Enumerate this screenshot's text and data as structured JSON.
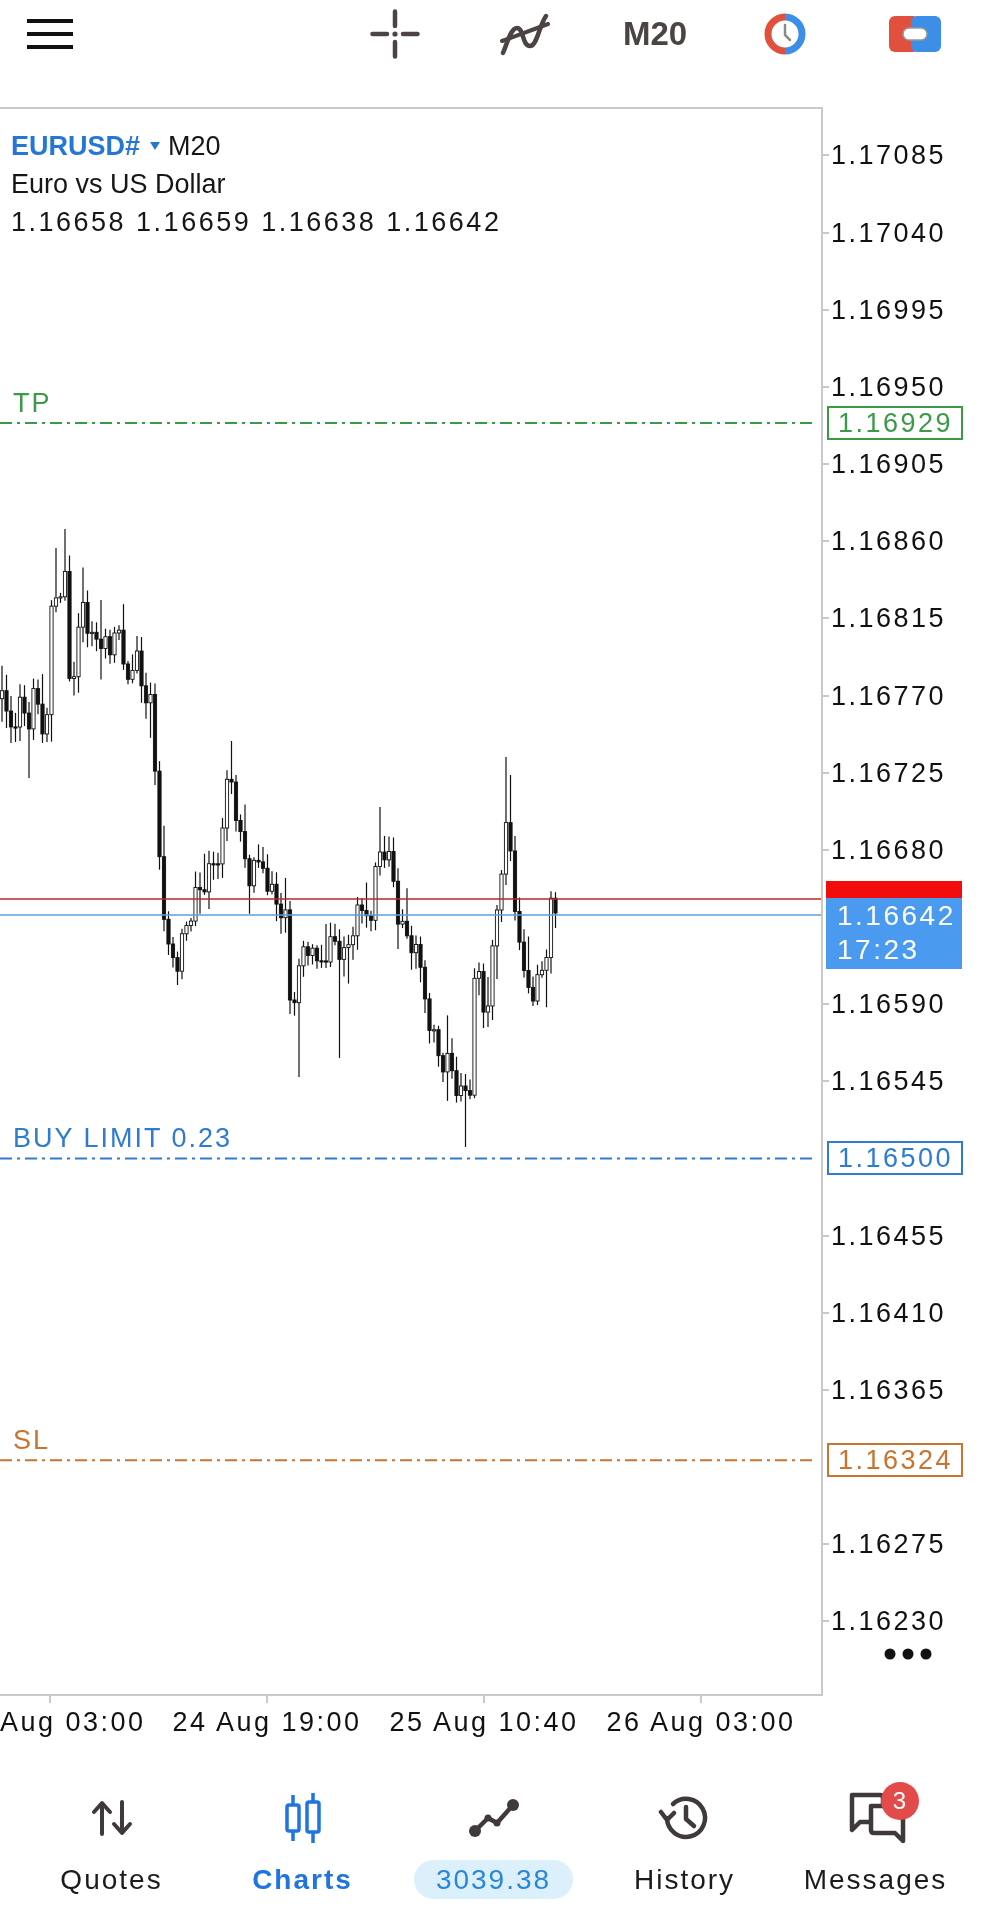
{
  "toolbar": {
    "timeframe": "M20"
  },
  "chart": {
    "symbol": "EURUSD#",
    "timeframe": "M20",
    "description": "Euro vs US Dollar",
    "ohlc": [
      "1.16658",
      "1.16659",
      "1.16638",
      "1.16642"
    ],
    "levels": [
      {
        "label": "TP",
        "price": "1.16929",
        "color": "#3b9a48"
      },
      {
        "label": "BUY LIMIT 0.23",
        "price": "1.16500",
        "color": "#2e7bd2"
      },
      {
        "label": "SL",
        "price": "1.16324",
        "color": "#c8742f"
      }
    ],
    "bid": {
      "price": "1.16642",
      "countdown": "17:23"
    },
    "price_axis": [
      "1.17085",
      "1.17040",
      "1.16995",
      "1.16950",
      "1.16905",
      "1.16860",
      "1.16815",
      "1.16770",
      "1.16725",
      "1.16680",
      "1.16590",
      "1.16545",
      "1.16455",
      "1.16410",
      "1.16365",
      "1.16275",
      "1.16230"
    ],
    "time_axis": [
      "Aug 03:00",
      "24 Aug 19:00",
      "25 Aug 10:40",
      "26 Aug 03:00"
    ]
  },
  "bottom_nav": [
    {
      "label": "Quotes",
      "kind": "tab",
      "selected": false
    },
    {
      "label": "Charts",
      "kind": "tab",
      "selected": true
    },
    {
      "label": "3039.38",
      "kind": "balance",
      "selected": false
    },
    {
      "label": "History",
      "kind": "tab",
      "selected": false
    },
    {
      "label": "Messages",
      "kind": "tab",
      "selected": false,
      "badge": "3"
    }
  ]
}
